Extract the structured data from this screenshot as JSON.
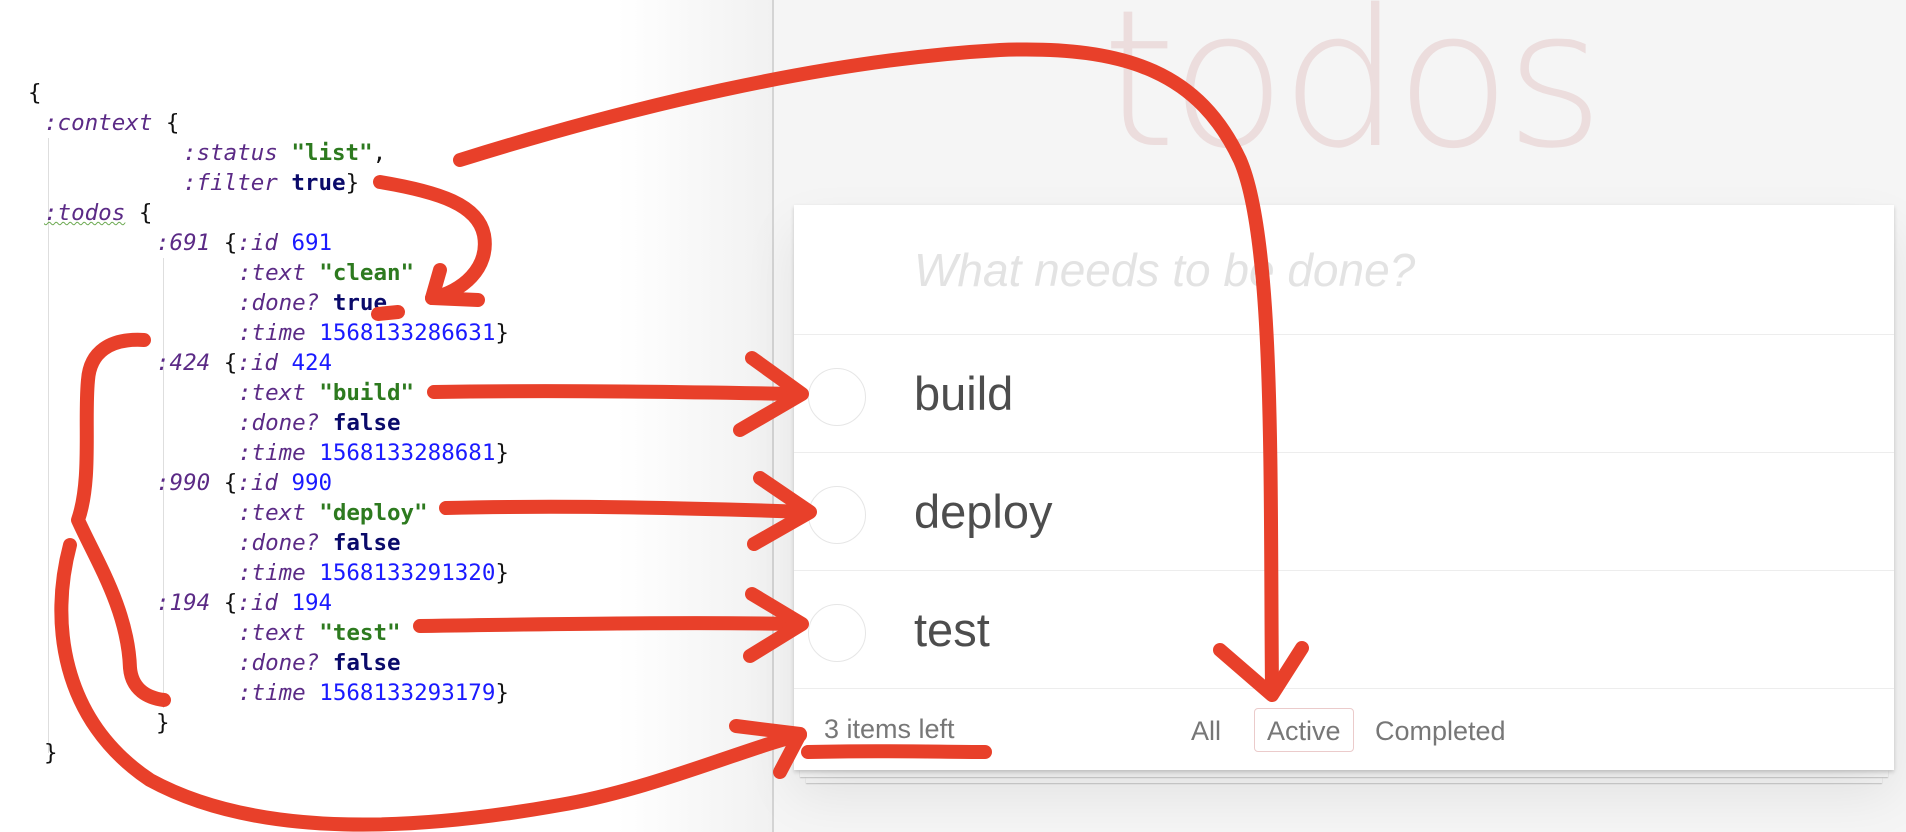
{
  "code": {
    "lines": [
      [
        {
          "c": "p",
          "t": "{"
        }
      ],
      [
        {
          "c": "k",
          "t": ":context"
        },
        {
          "c": "p",
          "t": " {"
        }
      ],
      [
        {
          "c": "k",
          "t": ":status"
        },
        {
          "c": "p",
          "t": " "
        },
        {
          "c": "s",
          "t": "\"list\""
        },
        {
          "c": "p",
          "t": ","
        }
      ],
      [
        {
          "c": "k",
          "t": ":filter"
        },
        {
          "c": "p",
          "t": " "
        },
        {
          "c": "b",
          "t": "true"
        },
        {
          "c": "p",
          "t": "}"
        }
      ],
      [
        {
          "c": "k squiggle",
          "t": ":todos"
        },
        {
          "c": "p",
          "t": " {"
        }
      ],
      [
        {
          "c": "k",
          "t": ":691"
        },
        {
          "c": "p",
          "t": " {"
        },
        {
          "c": "k",
          "t": ":id"
        },
        {
          "c": "p",
          "t": " "
        },
        {
          "c": "n",
          "t": "691"
        }
      ],
      [
        {
          "c": "k",
          "t": ":text"
        },
        {
          "c": "p",
          "t": " "
        },
        {
          "c": "s",
          "t": "\"clean\""
        }
      ],
      [
        {
          "c": "k",
          "t": ":done?"
        },
        {
          "c": "p",
          "t": " "
        },
        {
          "c": "b",
          "t": "true"
        }
      ],
      [
        {
          "c": "k",
          "t": ":time"
        },
        {
          "c": "p",
          "t": " "
        },
        {
          "c": "n",
          "t": "1568133286631"
        },
        {
          "c": "p",
          "t": "}"
        }
      ],
      [
        {
          "c": "k",
          "t": ":424"
        },
        {
          "c": "p",
          "t": " {"
        },
        {
          "c": "k",
          "t": ":id"
        },
        {
          "c": "p",
          "t": " "
        },
        {
          "c": "n",
          "t": "424"
        }
      ],
      [
        {
          "c": "k",
          "t": ":text"
        },
        {
          "c": "p",
          "t": " "
        },
        {
          "c": "s",
          "t": "\"build\""
        }
      ],
      [
        {
          "c": "k",
          "t": ":done?"
        },
        {
          "c": "p",
          "t": " "
        },
        {
          "c": "b",
          "t": "false"
        }
      ],
      [
        {
          "c": "k",
          "t": ":time"
        },
        {
          "c": "p",
          "t": " "
        },
        {
          "c": "n",
          "t": "1568133288681"
        },
        {
          "c": "p",
          "t": "}"
        }
      ],
      [
        {
          "c": "k",
          "t": ":990"
        },
        {
          "c": "p",
          "t": " {"
        },
        {
          "c": "k",
          "t": ":id"
        },
        {
          "c": "p",
          "t": " "
        },
        {
          "c": "n",
          "t": "990"
        }
      ],
      [
        {
          "c": "k",
          "t": ":text"
        },
        {
          "c": "p",
          "t": " "
        },
        {
          "c": "s",
          "t": "\"deploy\""
        }
      ],
      [
        {
          "c": "k",
          "t": ":done?"
        },
        {
          "c": "p",
          "t": " "
        },
        {
          "c": "b",
          "t": "false"
        }
      ],
      [
        {
          "c": "k",
          "t": ":time"
        },
        {
          "c": "p",
          "t": " "
        },
        {
          "c": "n",
          "t": "1568133291320"
        },
        {
          "c": "p",
          "t": "}"
        }
      ],
      [
        {
          "c": "k",
          "t": ":194"
        },
        {
          "c": "p",
          "t": " {"
        },
        {
          "c": "k",
          "t": ":id"
        },
        {
          "c": "p",
          "t": " "
        },
        {
          "c": "n",
          "t": "194"
        }
      ],
      [
        {
          "c": "k",
          "t": ":text"
        },
        {
          "c": "p",
          "t": " "
        },
        {
          "c": "s",
          "t": "\"test\""
        }
      ],
      [
        {
          "c": "k",
          "t": ":done?"
        },
        {
          "c": "p",
          "t": " "
        },
        {
          "c": "b",
          "t": "false"
        }
      ],
      [
        {
          "c": "k",
          "t": ":time"
        },
        {
          "c": "p",
          "t": " "
        },
        {
          "c": "n",
          "t": "1568133293179"
        },
        {
          "c": "p",
          "t": "}"
        }
      ],
      [
        {
          "c": "p",
          "t": "}"
        }
      ],
      [
        {
          "c": "p",
          "t": "}"
        }
      ]
    ]
  },
  "app": {
    "title": "todos",
    "new_todo_placeholder": "What needs to be done?",
    "todos": [
      {
        "label": "build",
        "done": false
      },
      {
        "label": "deploy",
        "done": false
      },
      {
        "label": "test",
        "done": false
      }
    ],
    "footer": {
      "items_left": "3 items left",
      "filters": [
        "All",
        "Active",
        "Completed"
      ],
      "selected_filter": "Active"
    }
  },
  "colors": {
    "annotation": "#e8402a",
    "keyword": "#5b2a86",
    "string": "#2d7a1f",
    "number": "#1a1aff",
    "boolean": "#0a0a6a",
    "title": "#af2f2f"
  }
}
